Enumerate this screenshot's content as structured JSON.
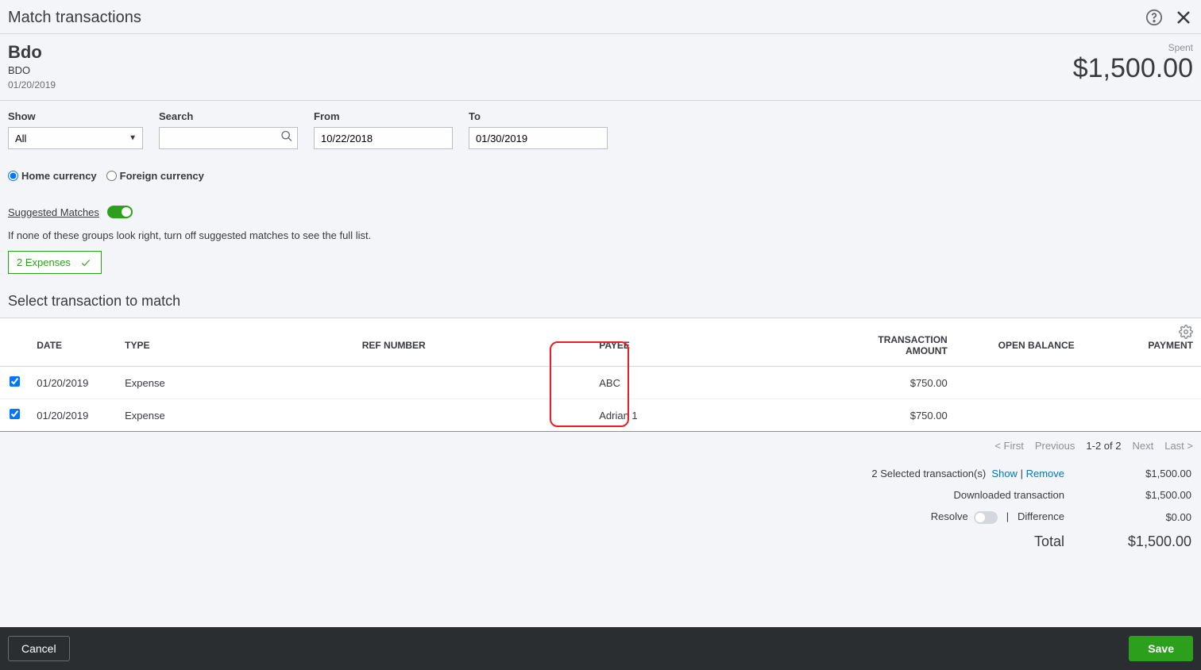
{
  "header": {
    "title": "Match transactions"
  },
  "summary": {
    "account": "Bdo",
    "account_sub": "BDO",
    "date": "01/20/2019",
    "spent_label": "Spent",
    "amount": "$1,500.00"
  },
  "filters": {
    "show_label": "Show",
    "show_value": "All",
    "search_label": "Search",
    "search_value": "",
    "from_label": "From",
    "from_value": "10/22/2018",
    "to_label": "To",
    "to_value": "01/30/2019"
  },
  "currency": {
    "home_label": "Home currency",
    "foreign_label": "Foreign currency",
    "selected": "home"
  },
  "suggested": {
    "label": "Suggested Matches",
    "on": true,
    "note": "If none of these groups look right, turn off suggested matches to see the full list.",
    "chip": "2 Expenses"
  },
  "section_title": "Select transaction to match",
  "table": {
    "cols": {
      "date": "DATE",
      "type": "TYPE",
      "ref": "REF NUMBER",
      "payee": "PAYEE",
      "txn_amt": "TRANSACTION AMOUNT",
      "open_bal": "OPEN BALANCE",
      "payment": "PAYMENT"
    },
    "rows": [
      {
        "checked": true,
        "date": "01/20/2019",
        "type": "Expense",
        "ref": "",
        "payee": "ABC",
        "txn_amt": "$750.00",
        "open_bal": "",
        "payment": ""
      },
      {
        "checked": true,
        "date": "01/20/2019",
        "type": "Expense",
        "ref": "",
        "payee": "Adrian 1",
        "txn_amt": "$750.00",
        "open_bal": "",
        "payment": ""
      }
    ]
  },
  "pager": {
    "first": "< First",
    "prev": "Previous",
    "range": "1-2 of 2",
    "next": "Next",
    "last": "Last >"
  },
  "totals": {
    "selected_prefix": "2 Selected transaction(s)",
    "show_link": "Show",
    "remove_link": "Remove",
    "selected_amount": "$1,500.00",
    "downloaded_label": "Downloaded transaction",
    "downloaded_amount": "$1,500.00",
    "resolve_label": "Resolve",
    "difference_label": "Difference",
    "difference_amount": "$0.00",
    "total_label": "Total",
    "total_amount": "$1,500.00"
  },
  "footer": {
    "cancel": "Cancel",
    "save": "Save"
  }
}
